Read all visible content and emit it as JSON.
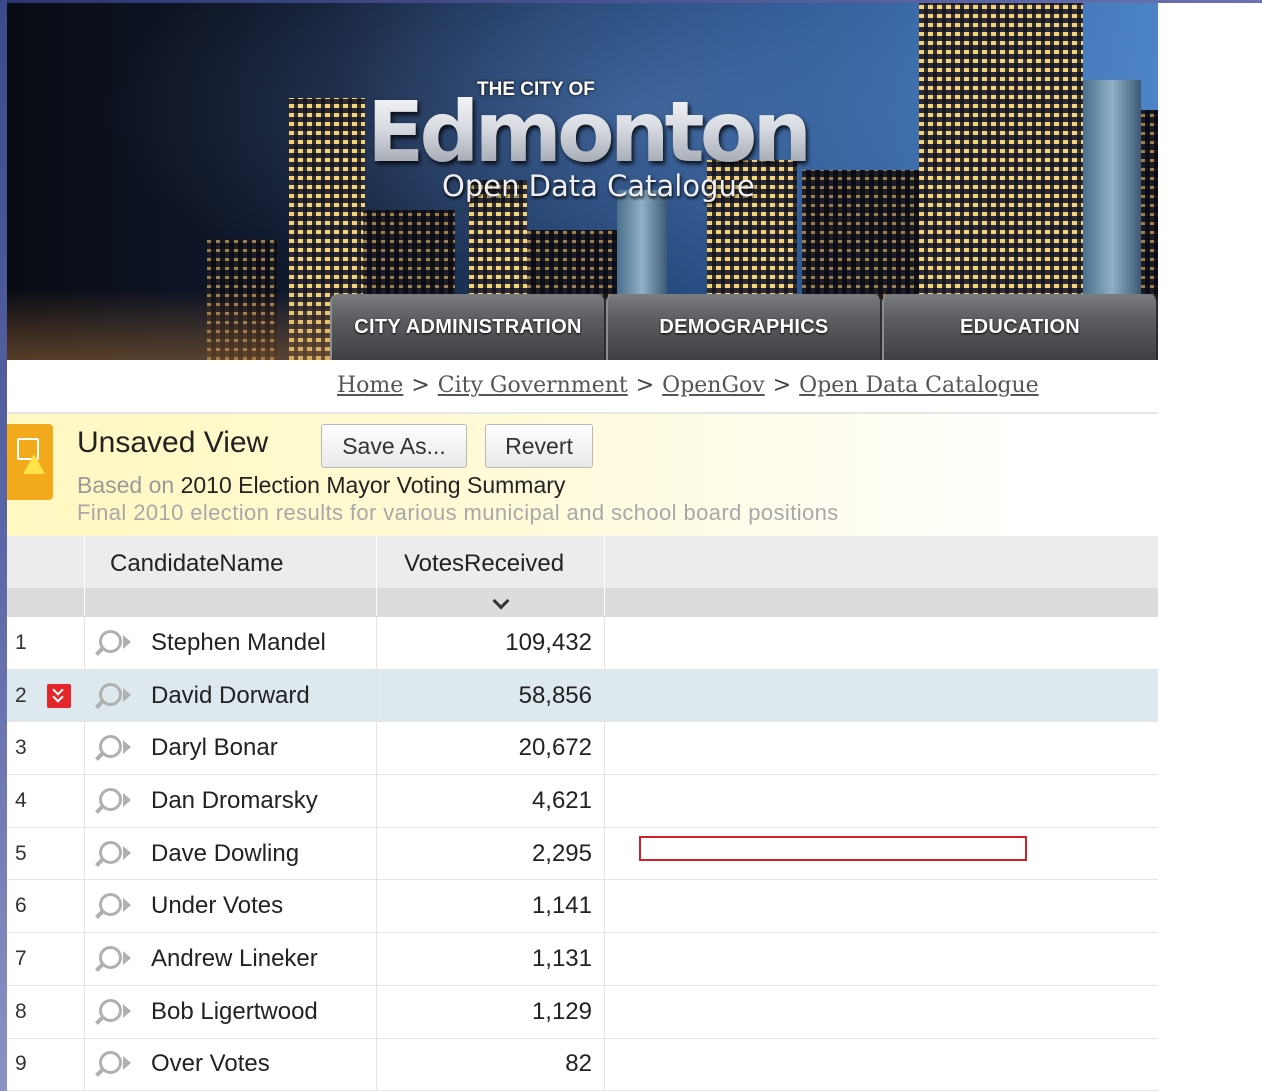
{
  "header": {
    "logo_prefix": "THE CITY OF",
    "logo_name": "Edmonton",
    "logo_subtitle": "Open Data Catalogue"
  },
  "nav": {
    "tabs": [
      {
        "label": "CITY ADMINISTRATION"
      },
      {
        "label": "DEMOGRAPHICS"
      },
      {
        "label": "EDUCATION"
      }
    ]
  },
  "breadcrumb": {
    "items": [
      "Home",
      "City Government",
      "OpenGov",
      "Open Data Catalogue"
    ],
    "separator": ">"
  },
  "view": {
    "title": "Unsaved View",
    "save_as_label": "Save As...",
    "revert_label": "Revert",
    "based_on_prefix": "Based on",
    "dataset_name": "2010 Election Mayor Voting Summary",
    "description": "Final 2010 election results for various municipal and school board positions",
    "icon": "unsaved-view-warning-icon"
  },
  "table": {
    "columns": [
      "CandidateName",
      "VotesReceived"
    ],
    "sorted_column": "VotesReceived",
    "sort_direction": "descending",
    "rows": [
      {
        "num": "1",
        "name": "Stephen Mandel",
        "votes": "109,432"
      },
      {
        "num": "2",
        "name": "David Dorward",
        "votes": "58,856"
      },
      {
        "num": "3",
        "name": "Daryl Bonar",
        "votes": "20,672"
      },
      {
        "num": "4",
        "name": "Dan Dromarsky",
        "votes": "4,621"
      },
      {
        "num": "5",
        "name": "Dave Dowling",
        "votes": "2,295"
      },
      {
        "num": "6",
        "name": "Under Votes",
        "votes": "1,141"
      },
      {
        "num": "7",
        "name": "Andrew Lineker",
        "votes": "1,131"
      },
      {
        "num": "8",
        "name": "Bob Ligertwood",
        "votes": "1,129"
      },
      {
        "num": "9",
        "name": "Over Votes",
        "votes": "82"
      }
    ],
    "selected_row": "2"
  },
  "colors": {
    "nav_tab": "#5a5c60",
    "view_bar": "#fff8c0",
    "selected_row": "#dde8ef",
    "row_menu_icon": "#e3262b",
    "highlight_border": "#d0202a"
  }
}
